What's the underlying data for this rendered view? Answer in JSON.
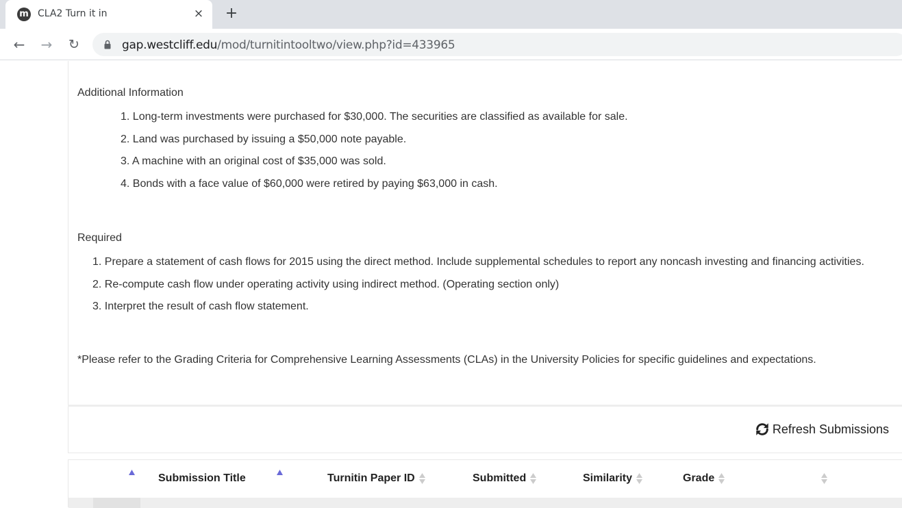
{
  "browser": {
    "tab_title": "CLA2 Turn it in",
    "favicon_letter": "m",
    "close_glyph": "×",
    "new_tab_glyph": "+",
    "url_host": "gap.westcliff.edu",
    "url_path": "/mod/turnitintooltwo/view.php?id=433965",
    "back_glyph": "←",
    "forward_glyph": "→",
    "reload_glyph": "↻"
  },
  "assignment": {
    "additional_heading": "Additional Information",
    "additional_items": [
      "1. Long-term investments were purchased for $30,000. The securities are classified as available for sale.",
      "2. Land was purchased by issuing a $50,000 note payable.",
      "3. A machine with an original cost of $35,000 was sold.",
      "4. Bonds with a face value of $60,000 were retired by paying $63,000 in cash."
    ],
    "required_heading": "Required",
    "required_items": [
      "1. Prepare a statement of cash flows for 2015 using the direct method. Include supplemental schedules to report any noncash investing and financing activities.",
      "2. Re-compute cash flow under operating activity using indirect method. (Operating section only)",
      "3. Interpret the result of cash flow statement."
    ],
    "note": "*Please refer to the Grading Criteria for Comprehensive Learning Assessments (CLAs) in the University Policies for specific guidelines and expectations."
  },
  "submissions": {
    "refresh_label": "Refresh Submissions",
    "columns": {
      "title": "Submission Title",
      "paper_id": "Turnitin Paper ID",
      "submitted": "Submitted",
      "similarity": "Similarity",
      "grade": "Grade"
    }
  },
  "colors": {
    "sort_active": "#6a6ad8",
    "sort_inactive": "#cccccc"
  },
  "icons": [
    "moodle-favicon-icon",
    "close-icon",
    "plus-icon",
    "back-arrow-icon",
    "forward-arrow-icon",
    "reload-icon",
    "lock-icon",
    "refresh-icon",
    "sort-asc-icon",
    "sort-both-icon"
  ]
}
